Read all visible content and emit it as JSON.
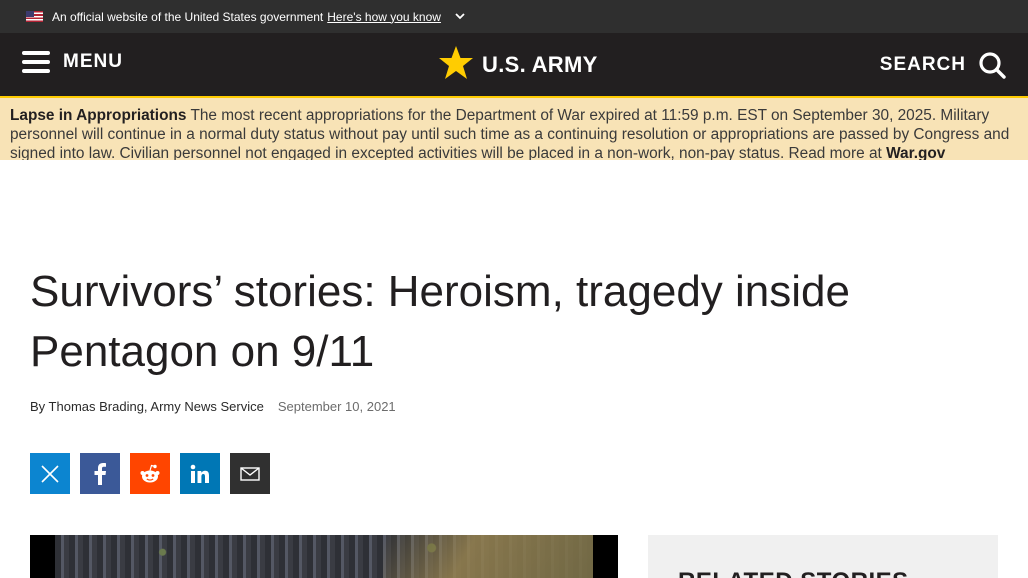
{
  "gov_banner": {
    "text": "An official website of the United States government",
    "link": "Here's how you know"
  },
  "header": {
    "menu_label": "MENU",
    "logo_text": "U.S. ARMY",
    "search_label": "SEARCH"
  },
  "alert": {
    "title": "Lapse in Appropriations",
    "body": "The most recent appropriations for the Department of War expired at 11:59 p.m. EST on September 30, 2025. Military personnel will continue in a normal duty status without pay until such time as a continuing resolution or appropriations are passed by Congress and signed into law. Civilian personnel not engaged in excepted activities will be placed in a non-work, non-pay status. Read more at",
    "link": "War.gov"
  },
  "article": {
    "title": "Survivors’ stories: Heroism, tragedy inside Pentagon on 9/11",
    "byline": "By Thomas Brading, Army News Service",
    "date": "September 10, 2021"
  },
  "share": {
    "icons": [
      "x-icon",
      "facebook-icon",
      "reddit-icon",
      "linkedin-icon",
      "email-icon"
    ]
  },
  "sidebar": {
    "related_title": "RELATED STORIES"
  },
  "colors": {
    "header_bg": "#221f20",
    "army_gold": "#ffcc01",
    "alert_bg": "#f8e3b6"
  }
}
